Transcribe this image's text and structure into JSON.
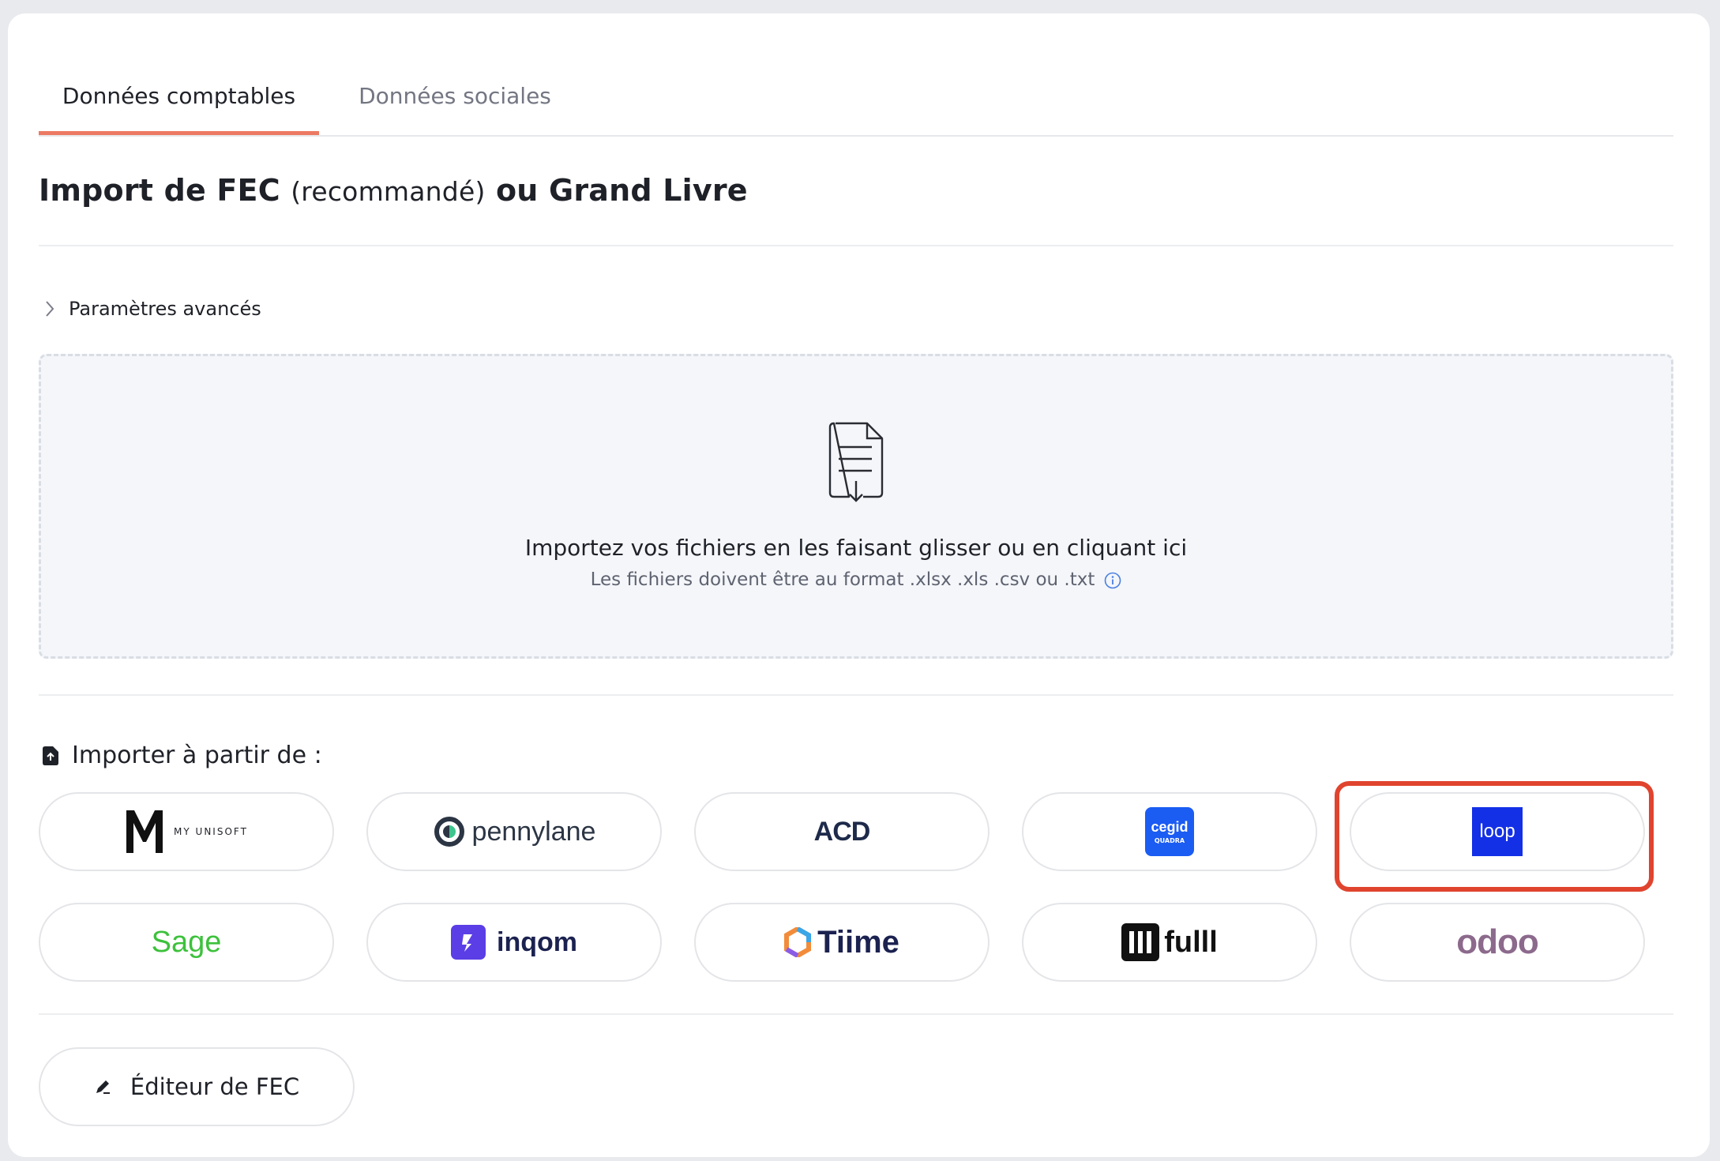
{
  "tabs": [
    {
      "label": "Données comptables",
      "active": true
    },
    {
      "label": "Données sociales",
      "active": false
    }
  ],
  "section": {
    "title_start": "Import de FEC ",
    "title_paren": "(recommandé)",
    "title_end": " ou Grand Livre"
  },
  "advanced": {
    "label": "Paramètres avancés"
  },
  "dropzone": {
    "main": "Importez vos fichiers en les faisant glisser ou en cliquant ici",
    "sub": "Les fichiers doivent être au format .xlsx .xls .csv ou .txt"
  },
  "import_from": {
    "label": "Importer à partir de :"
  },
  "integrations": [
    {
      "name": "MY UNISOFT",
      "logo_letter": "M"
    },
    {
      "name": "pennylane"
    },
    {
      "name": "ACD"
    },
    {
      "name": "cegid",
      "sub": "QUADRA",
      "color": "#1b5cf3"
    },
    {
      "name": "loop",
      "color": "#1330e6",
      "highlighted": true
    },
    {
      "name": "Sage",
      "color": "#3dc13c"
    },
    {
      "name": "inqom",
      "color": "#5b3ee6"
    },
    {
      "name": "Tiime"
    },
    {
      "name": "fulll"
    },
    {
      "name": "odoo",
      "color": "#8c6a8c"
    }
  ],
  "editor": {
    "label": "Éditeur de FEC"
  },
  "colors": {
    "accent": "#ec7a63",
    "highlight": "#e0442e",
    "info": "#4a7fe0"
  }
}
